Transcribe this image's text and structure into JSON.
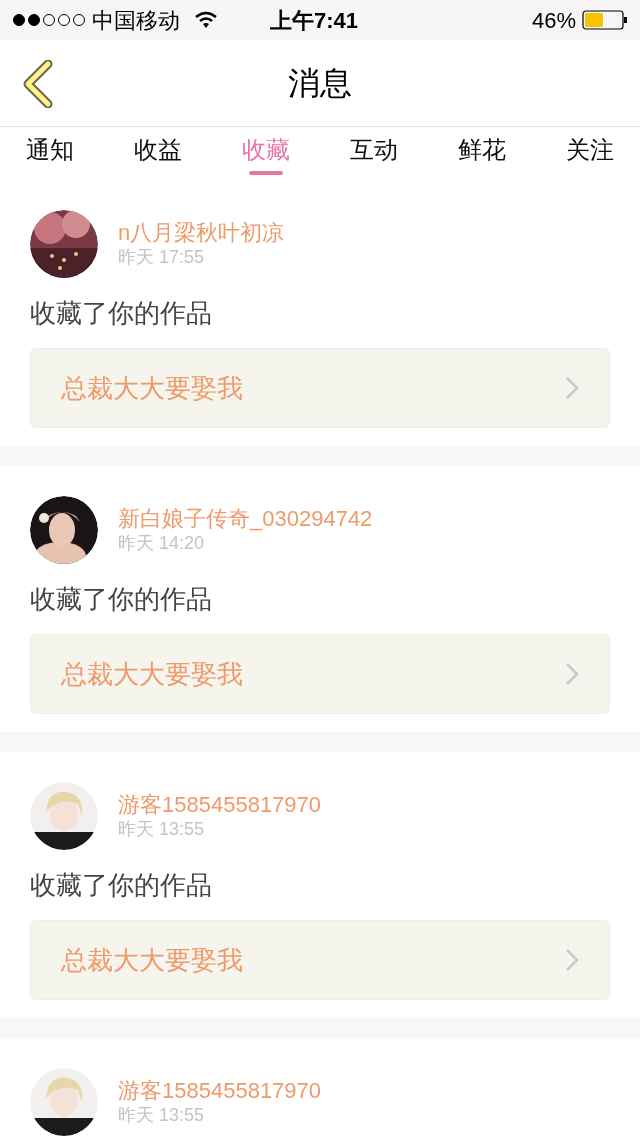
{
  "status_bar": {
    "carrier": "中国移动",
    "time": "上午7:41",
    "battery": "46%"
  },
  "nav": {
    "title": "消息"
  },
  "tabs": [
    {
      "label": "通知",
      "selected": false
    },
    {
      "label": "收益",
      "selected": false
    },
    {
      "label": "收藏",
      "selected": true
    },
    {
      "label": "互动",
      "selected": false
    },
    {
      "label": "鲜花",
      "selected": false
    },
    {
      "label": "关注",
      "selected": false
    }
  ],
  "messages": [
    {
      "name": "n八月梁秋叶初凉",
      "time": "昨天 17:55",
      "action": "收藏了你的作品",
      "work": "总裁大大要娶我"
    },
    {
      "name": "新白娘子传奇_030294742",
      "time": "昨天 14:20",
      "action": "收藏了你的作品",
      "work": "总裁大大要娶我"
    },
    {
      "name": "游客1585455817970",
      "time": "昨天 13:55",
      "action": "收藏了你的作品",
      "work": "总裁大大要娶我"
    },
    {
      "name": "游客1585455817970",
      "time": "昨天 13:55"
    }
  ]
}
